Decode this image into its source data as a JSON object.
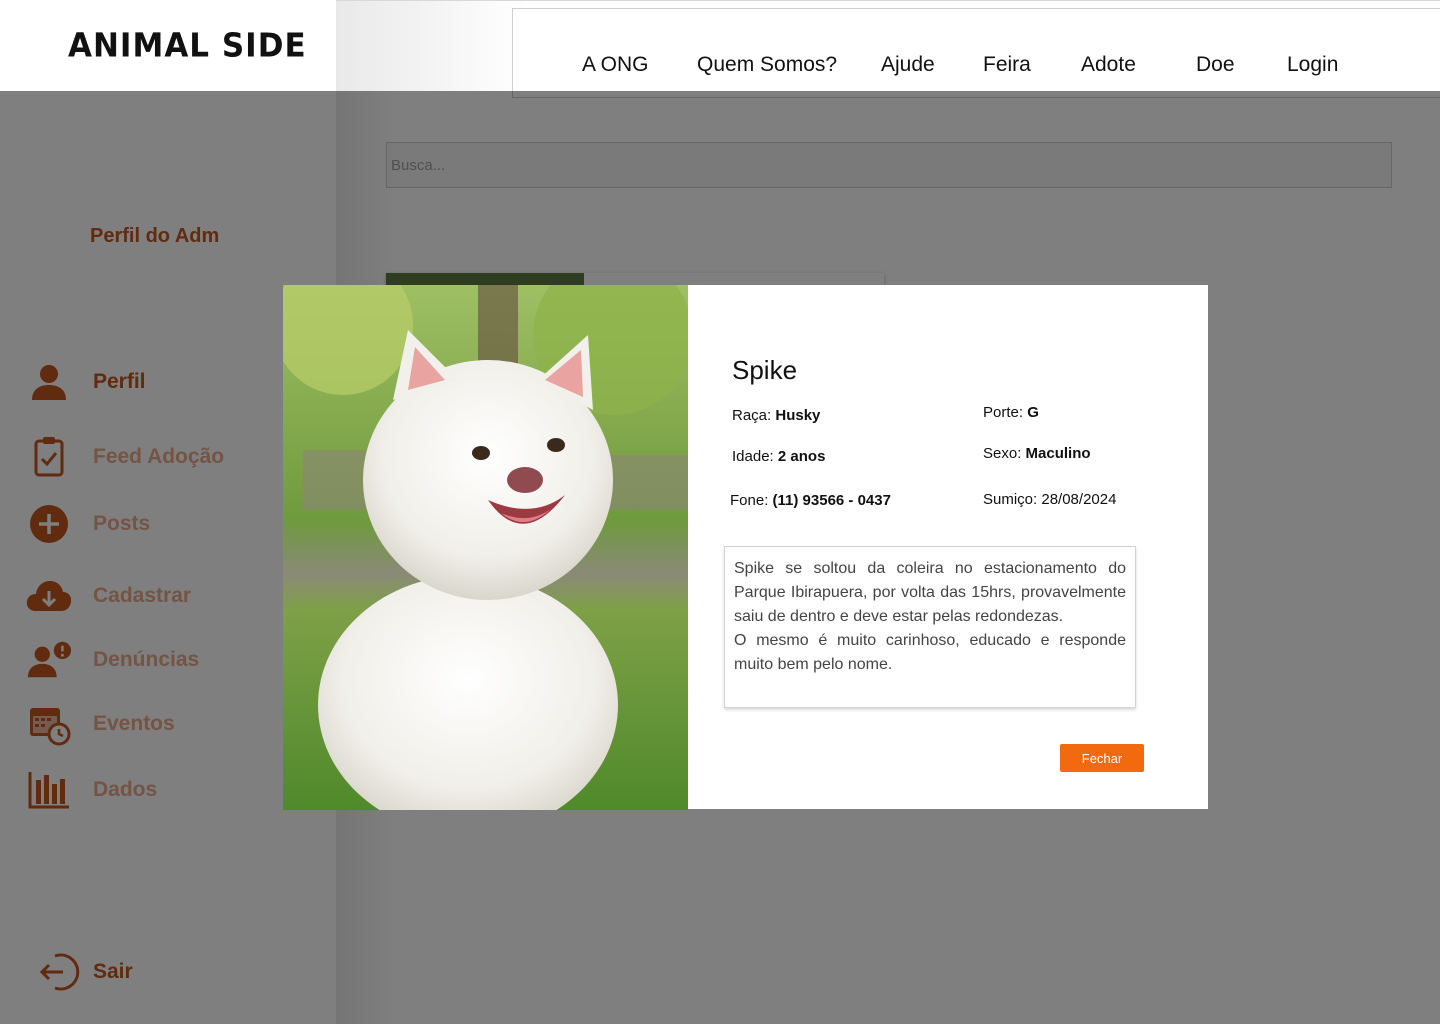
{
  "brand": {
    "logo": "ANIMAL SIDE",
    "accent": "#c0571f",
    "accent_light": "#e8a98a",
    "button_color": "#f26a0d"
  },
  "sidebar": {
    "title": "Perfil do Adm",
    "items": [
      {
        "label": "Perfil",
        "icon": "user-icon"
      },
      {
        "label": "Feed Adoção",
        "icon": "clipboard-check-icon"
      },
      {
        "label": "Posts",
        "icon": "plus-circle-icon"
      },
      {
        "label": "Cadastrar",
        "icon": "cloud-download-icon"
      },
      {
        "label": "Denúncias",
        "icon": "user-alert-icon"
      },
      {
        "label": "Eventos",
        "icon": "calendar-clock-icon"
      },
      {
        "label": "Dados",
        "icon": "bar-chart-icon"
      }
    ],
    "logout": {
      "label": "Sair",
      "icon": "logout-icon"
    }
  },
  "header": {
    "menu": [
      "A ONG",
      "Quem Somos?",
      "Ajude",
      "Feira",
      "Adote",
      "Doe",
      "Login"
    ]
  },
  "search": {
    "placeholder": "Busca..."
  },
  "modal": {
    "name": "Spike",
    "raca_label": "Raça:",
    "raca": "Husky",
    "idade_label": "Idade:",
    "idade": "2 anos",
    "fone_label": "Fone:",
    "fone": "(11) 93566 - 0437",
    "porte_label": "Porte:",
    "porte": "G",
    "sexo_label": "Sexo:",
    "sexo": "Maculino",
    "sumico_label": "Sumiço:",
    "sumico": "28/08/2024",
    "description_1": "Spike se soltou da coleira no estacionamento do Parque Ibirapuera, por volta das 15hrs, provavelmente saiu de dentro e deve estar pelas redondezas.",
    "description_2": "O mesmo é muito carinhoso, educado e responde muito bem pelo nome.",
    "close_label": "Fechar"
  }
}
